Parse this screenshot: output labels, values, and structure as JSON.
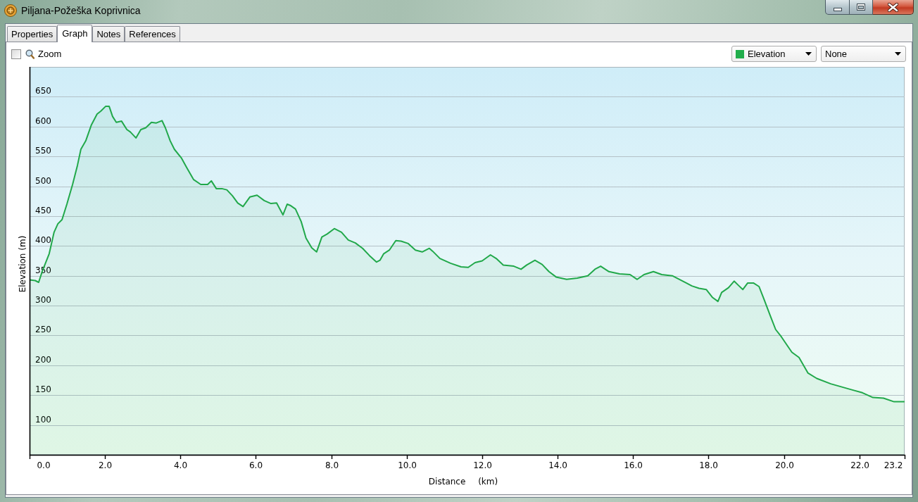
{
  "window": {
    "title": "Piljana-Požeška Koprivnica"
  },
  "tabs": [
    {
      "label": "Properties",
      "selected": false
    },
    {
      "label": "Graph",
      "selected": true
    },
    {
      "label": "Notes",
      "selected": false
    },
    {
      "label": "References",
      "selected": false
    }
  ],
  "graph": {
    "zoom": {
      "label": "Zoom",
      "checked": false
    },
    "dropdowns": [
      {
        "value": "Elevation",
        "color": "#21ad4b"
      },
      {
        "value": "None"
      }
    ],
    "chart_data": {
      "type": "area",
      "xlabel": "Distance (km)",
      "ylabel": "Elevation (m)",
      "grid": true,
      "xlim": [
        0,
        23.2
      ],
      "ylim": [
        50,
        700
      ],
      "xticks": [
        {
          "value": 0,
          "label": "0.0"
        },
        {
          "value": 2,
          "label": "2.0"
        },
        {
          "value": 4,
          "label": "4.0"
        },
        {
          "value": 6,
          "label": "6.0"
        },
        {
          "value": 8,
          "label": "8.0"
        },
        {
          "value": 10,
          "label": "10.0"
        },
        {
          "value": 12,
          "label": "12.0"
        },
        {
          "value": 14,
          "label": "14.0"
        },
        {
          "value": 16,
          "label": "16.0"
        },
        {
          "value": 18,
          "label": "18.0"
        },
        {
          "value": 20,
          "label": "20.0"
        },
        {
          "value": 22,
          "label": "22.0"
        },
        {
          "value": 23.2,
          "label": "23.2"
        }
      ],
      "yticks": [
        100,
        150,
        200,
        250,
        300,
        350,
        400,
        450,
        500,
        550,
        600,
        650
      ],
      "x": [
        0,
        0.15,
        0.24,
        0.34,
        0.52,
        0.65,
        0.75,
        0.86,
        0.99,
        1.14,
        1.27,
        1.36,
        1.49,
        1.64,
        1.79,
        1.89,
        2.02,
        2.11,
        2.2,
        2.3,
        2.44,
        2.58,
        2.67,
        2.82,
        2.95,
        3.08,
        3.23,
        3.36,
        3.51,
        3.6,
        3.73,
        3.84,
        4.03,
        4.16,
        4.35,
        4.54,
        4.72,
        4.82,
        4.95,
        5.1,
        5.23,
        5.38,
        5.52,
        5.66,
        5.84,
        6.03,
        6.22,
        6.4,
        6.55,
        6.72,
        6.83,
        6.91,
        7.05,
        7.2,
        7.33,
        7.48,
        7.61,
        7.75,
        7.89,
        8.08,
        8.27,
        8.45,
        8.64,
        8.83,
        9.01,
        9.2,
        9.29,
        9.39,
        9.54,
        9.71,
        9.85,
        10.04,
        10.23,
        10.41,
        10.6,
        10.69,
        10.88,
        11.16,
        11.44,
        11.63,
        11.81,
        12.0,
        12.22,
        12.37,
        12.56,
        12.84,
        13.03,
        13.18,
        13.4,
        13.59,
        13.77,
        13.96,
        14.24,
        14.52,
        14.8,
        14.99,
        15.14,
        15.36,
        15.64,
        15.92,
        16.11,
        16.29,
        16.54,
        16.76,
        17.04,
        17.23,
        17.41,
        17.56,
        17.75,
        17.94,
        18.1,
        18.25,
        18.35,
        18.53,
        18.68,
        18.81,
        18.91,
        19.04,
        19.19,
        19.34,
        19.47,
        19.65,
        19.78,
        19.93,
        20.08,
        20.21,
        20.4,
        20.64,
        20.87,
        21.24,
        21.52,
        21.8,
        22.08,
        22.36,
        22.64,
        22.92,
        23.2
      ],
      "series": [
        {
          "color": "#21a84a",
          "values": [
            343,
            342,
            339,
            358,
            387,
            423,
            437,
            444,
            470,
            503,
            535,
            562,
            576,
            603,
            621,
            626,
            634,
            634,
            617,
            607,
            609,
            595,
            591,
            581,
            595,
            598,
            607,
            606,
            610,
            598,
            576,
            562,
            547,
            532,
            511,
            503,
            503,
            509,
            496,
            496,
            494,
            484,
            472,
            466,
            482,
            485,
            476,
            471,
            472,
            452,
            470,
            468,
            462,
            441,
            413,
            397,
            390,
            415,
            420,
            429,
            423,
            410,
            405,
            396,
            384,
            373,
            376,
            387,
            393,
            409,
            408,
            404,
            393,
            390,
            396,
            391,
            379,
            371,
            365,
            364,
            372,
            375,
            385,
            379,
            368,
            366,
            361,
            368,
            376,
            369,
            357,
            348,
            344,
            346,
            350,
            361,
            366,
            357,
            353,
            352,
            344,
            352,
            357,
            352,
            350,
            344,
            338,
            333,
            329,
            327,
            314,
            307,
            322,
            330,
            341,
            333,
            327,
            338,
            338,
            332,
            311,
            281,
            260,
            248,
            234,
            222,
            213,
            187,
            178,
            169,
            164,
            159,
            154,
            146,
            145,
            139,
            139
          ]
        }
      ]
    }
  }
}
